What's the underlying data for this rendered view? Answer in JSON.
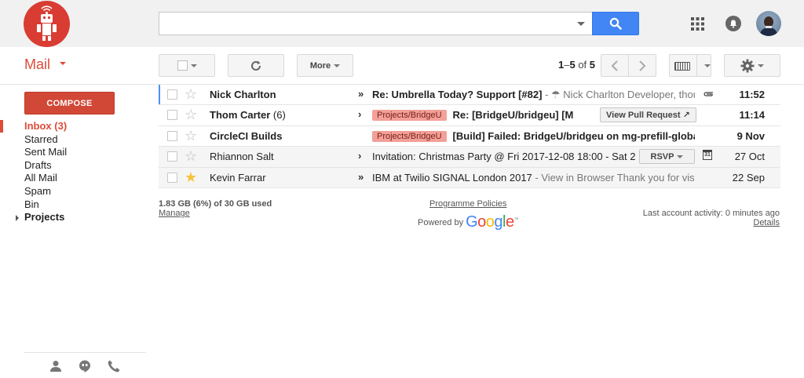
{
  "header": {
    "search": {
      "value": "",
      "placeholder": ""
    },
    "colors": {
      "brand_red": "#d93c32",
      "search_blue": "#4285f4"
    }
  },
  "toolbar": {
    "mail_label": "Mail",
    "more_label": "More",
    "pager": {
      "start": "1",
      "end": "5",
      "of_label": "of",
      "total": "5"
    }
  },
  "sidebar": {
    "compose_label": "COMPOSE",
    "items": [
      {
        "label": "Inbox (3)",
        "active": true
      },
      {
        "label": "Starred"
      },
      {
        "label": "Sent Mail"
      },
      {
        "label": "Drafts"
      },
      {
        "label": "All Mail"
      },
      {
        "label": "Spam"
      },
      {
        "label": "Bin"
      },
      {
        "label": "Projects",
        "bold": true
      }
    ],
    "bottom_icons": [
      "person-icon",
      "hangouts-icon",
      "phone-icon"
    ]
  },
  "messages": [
    {
      "sender": "Nick Charlton",
      "count": "",
      "chevron": "»",
      "label": "",
      "subject": "Re: Umbrella Today? Support [#82]",
      "snippet": " - ☂ Nick Charlton Developer, thoughtbot",
      "action": "",
      "time": "11:52",
      "unread": true,
      "starred": false,
      "has_attachment": true
    },
    {
      "sender": "Thom Carter",
      "count": "(6)",
      "chevron": "›",
      "label": "Projects/BridgeU",
      "subject": "Re: [BridgeU/bridgeu] [Ma",
      "snippet": "",
      "action": "View Pull Request ↗",
      "time": "11:14",
      "unread": true,
      "starred": false
    },
    {
      "sender": "CircleCI Builds",
      "count": "",
      "chevron": "",
      "label": "Projects/BridgeU",
      "subject": "[Build] Failed: BridgeU/bridgeu on mg-prefill-global",
      "snippet": "",
      "action": "",
      "time": "9 Nov",
      "unread": true,
      "starred": false
    },
    {
      "sender": "Rhiannon Salt",
      "count": "",
      "chevron": "›",
      "label": "",
      "subject": "Invitation: Christmas Party @ Fri 2017-12-08 18:00 - Sat 2",
      "snippet": "",
      "action": "RSVP",
      "time": "27 Oct",
      "unread": false,
      "starred": false,
      "calendar_day": "31"
    },
    {
      "sender": "Kevin Farrar",
      "count": "",
      "chevron": "»",
      "label": "",
      "subject": "IBM at Twilio SIGNAL London 2017",
      "snippet": " - View in Browser Thank you for visiting",
      "action": "",
      "time": "22 Sep",
      "unread": false,
      "starred": true
    }
  ],
  "footer": {
    "storage_used": "1.83 GB (6%) of 30 GB used",
    "manage": "Manage",
    "policies": "Programme Policies",
    "powered_by": "Powered by",
    "google_letters": [
      "G",
      "o",
      "o",
      "g",
      "l",
      "e"
    ],
    "google_colors": [
      "#4285f4",
      "#ea4335",
      "#fbbc05",
      "#4285f4",
      "#34a853",
      "#ea4335"
    ],
    "last_activity": "Last account activity: 0 minutes ago",
    "details": "Details"
  }
}
